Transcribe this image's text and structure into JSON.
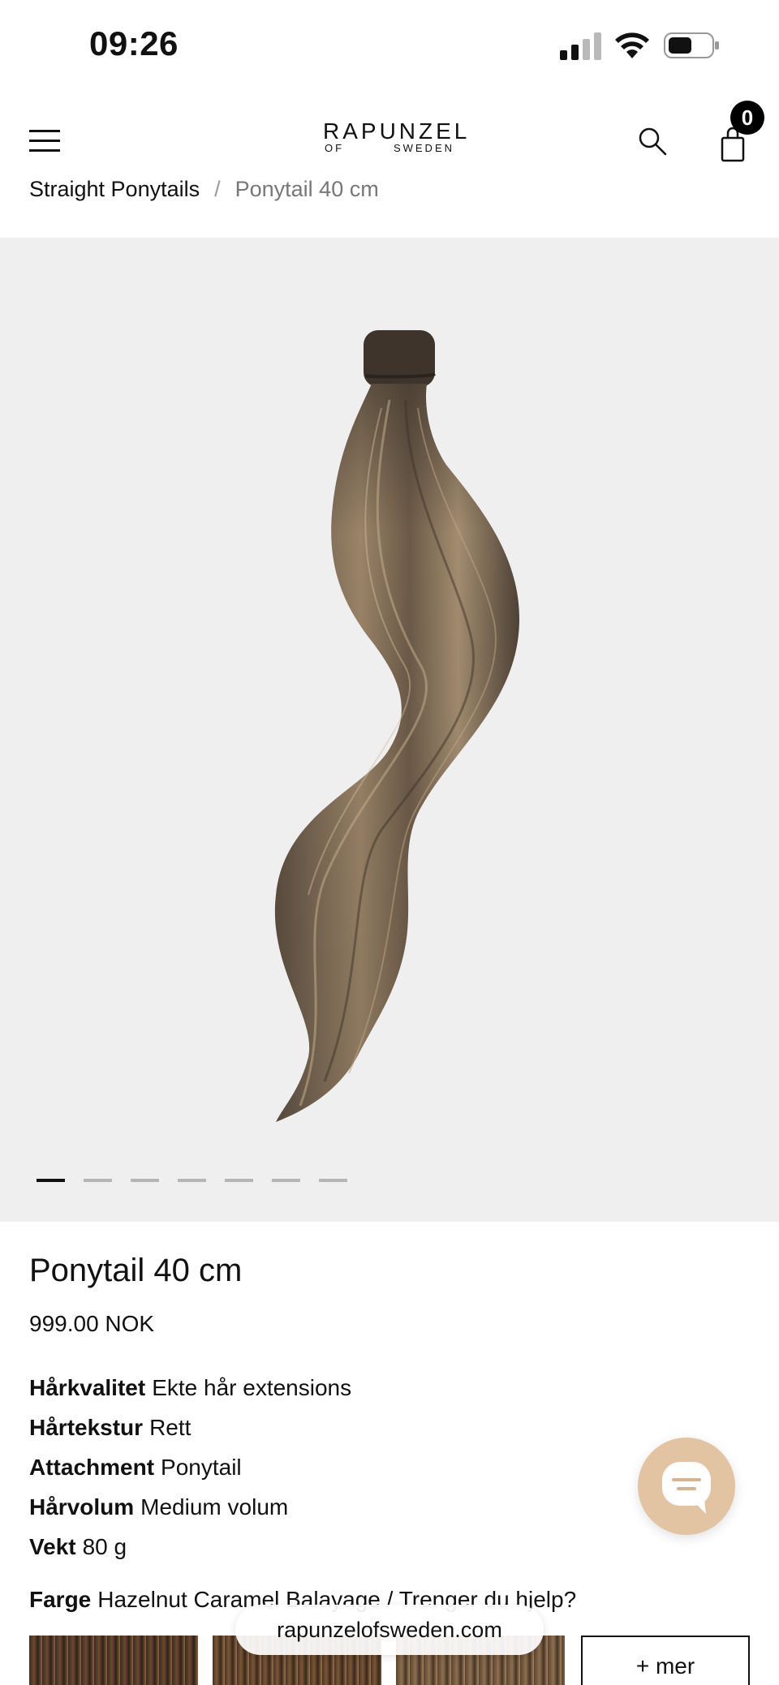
{
  "status_bar": {
    "time": "09:26"
  },
  "header": {
    "logo_main": "RAPUNZEL",
    "logo_sub_left": "OF",
    "logo_sub_right": "SWEDEN",
    "cart_count": "0"
  },
  "breadcrumb": {
    "items": [
      "Straight Ponytails",
      "Ponytail 40 cm"
    ],
    "separator": "/"
  },
  "gallery": {
    "image_count": 7,
    "active_index": 0
  },
  "product": {
    "title": "Ponytail 40 cm",
    "price": "999.00 NOK",
    "attributes": [
      {
        "label": "Hårkvalitet",
        "value": "Ekte hår extensions"
      },
      {
        "label": "Hårtekstur",
        "value": "Rett"
      },
      {
        "label": "Attachment",
        "value": "Ponytail"
      },
      {
        "label": "Hårvolum",
        "value": "Medium volum"
      },
      {
        "label": "Vekt",
        "value": "80 g"
      }
    ],
    "color_label": "Farge",
    "color_value": "Hazelnut Caramel Balayage / Trenger du hjelp?",
    "more_label": "+ mer"
  },
  "browser": {
    "url": "rapunzelofsweden.com"
  },
  "colors": {
    "chat_accent": "#e2c3a2",
    "gallery_bg": "#f0eff0"
  }
}
